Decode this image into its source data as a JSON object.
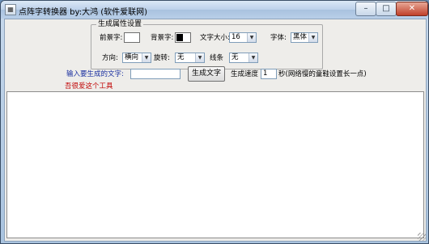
{
  "window": {
    "title": "点阵字转换器  by:大鸿 (软件爱联网)",
    "minimize_glyph": "–",
    "maximize_glyph": "□",
    "close_glyph": "✕"
  },
  "settings": {
    "group_title": "生成属性设置",
    "foreground_label": "前景字:",
    "background_label": "背景字:",
    "font_size_label": "文字大小:",
    "font_size_value": "16",
    "font_label": "字体:",
    "font_value": "黑体",
    "direction_label": "方向:",
    "direction_value": "横向",
    "rotate_label": "旋转:",
    "rotate_value": "无",
    "line_label": "线条",
    "line_value": "无",
    "foreground_color": "#ffffff",
    "background_color": "#000000"
  },
  "input": {
    "prompt_label": "输入要生成的文字:",
    "text_value": "",
    "generate_button": "生成文字",
    "speed_label": "生成速度",
    "speed_value": "1",
    "speed_hint": "秒(网络慢的童鞋设置长一点)"
  },
  "footer_hint": "吾很爱这个工具",
  "colors": {
    "hint_red": "#c00000",
    "hint_blue": "#1a2fa0",
    "titlebar": "#bcd1ea"
  }
}
